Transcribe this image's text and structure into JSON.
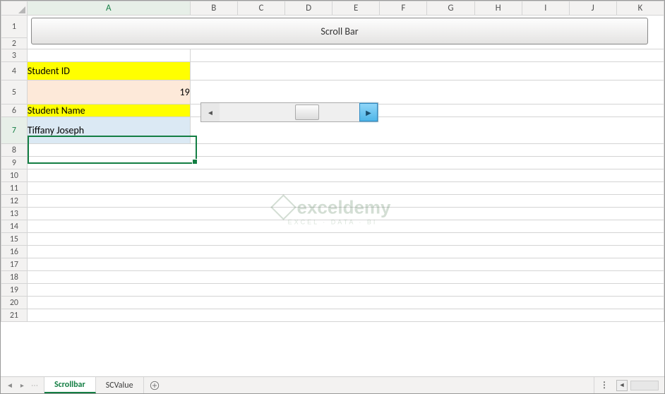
{
  "columns": [
    "A",
    "B",
    "C",
    "D",
    "E",
    "F",
    "G",
    "H",
    "I",
    "J",
    "K"
  ],
  "rows": [
    "1",
    "2",
    "3",
    "4",
    "5",
    "6",
    "7",
    "8",
    "9",
    "10",
    "11",
    "12",
    "13",
    "14",
    "15",
    "16",
    "17",
    "18",
    "19",
    "20",
    "21"
  ],
  "banner": {
    "title": "Scroll Bar"
  },
  "cells": {
    "A4": "Student ID",
    "A5": "19",
    "A6": "Student Name",
    "A7": "Tiffany Joseph"
  },
  "selected": {
    "cell": "A7",
    "row": "7",
    "col": "A"
  },
  "form_control": {
    "type": "scrollbar",
    "value": 19
  },
  "tabs": {
    "items": [
      {
        "label": "Scrollbar",
        "active": true
      },
      {
        "label": "SCValue",
        "active": false
      }
    ],
    "add_tooltip": "New sheet"
  },
  "watermark": {
    "brand": "exceldemy",
    "sub": "EXCEL · DATA · BI"
  }
}
